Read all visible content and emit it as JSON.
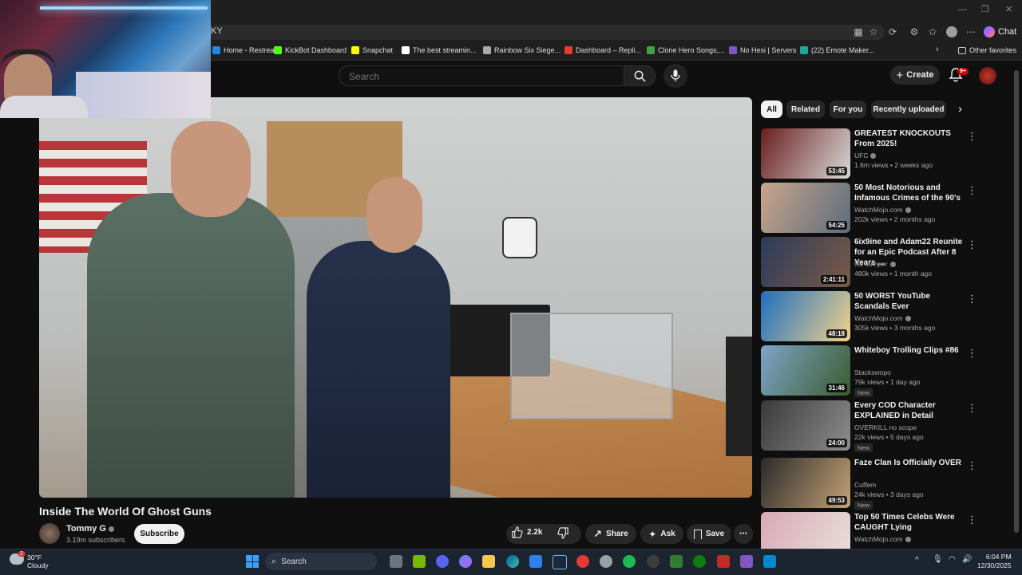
{
  "browser": {
    "address_text": "KY",
    "chat_label": "Chat",
    "bookmarks": [
      {
        "label": "Home - Restream",
        "color": "#1e88e5"
      },
      {
        "label": "KickBot Dashboard",
        "color": "#53fc18"
      },
      {
        "label": "Snapchat",
        "color": "#fffc00"
      },
      {
        "label": "The best streamin...",
        "color": "#ffffff"
      },
      {
        "label": "Rainbow Six Siege...",
        "color": "#aaaaaa"
      },
      {
        "label": "Dashboard – Repli...",
        "color": "#e53935"
      },
      {
        "label": "Clone Hero Songs,...",
        "color": "#43a047"
      },
      {
        "label": "No Hesi | Servers",
        "color": "#7e57c2"
      },
      {
        "label": "(22) Emote Maker...",
        "color": "#26a69a"
      }
    ],
    "other_favorites": "Other favorites"
  },
  "youtube": {
    "search_placeholder": "Search",
    "create_label": "Create",
    "notifications_badge": "9+",
    "video": {
      "title": "Inside The World Of Ghost Guns",
      "channel": "Tommy G",
      "subscribers": "3.19m subscribers",
      "subscribe_label": "Subscribe",
      "likes": "2.2k",
      "share_label": "Share",
      "ask_label": "Ask",
      "save_label": "Save"
    },
    "chips": [
      "All",
      "Related",
      "For you",
      "Recently uploaded"
    ],
    "recommendations": [
      {
        "title": "GREATEST KNOCKOUTS From 2025!",
        "channel": "UFC",
        "verified": true,
        "meta": "1.6m views • 2 weeks ago",
        "duration": "53:45",
        "new": "",
        "thumb_a": "#6b1e1e",
        "thumb_b": "#d9d9d9"
      },
      {
        "title": "50 Most Notorious and Infamous Crimes of the 90's",
        "channel": "WatchMojo.com",
        "verified": true,
        "meta": "202k views • 2 months ago",
        "duration": "54:25",
        "new": "",
        "thumb_a": "#caa58b",
        "thumb_b": "#5b6d7d"
      },
      {
        "title": "6ix9ine and Adam22 Reunite for an Epic Podcast After 8 Years ...",
        "channel": "No Jumper",
        "verified": true,
        "meta": "480k views • 1 month ago",
        "duration": "2:41:11",
        "new": "",
        "thumb_a": "#2c3b5a",
        "thumb_b": "#7a5a48"
      },
      {
        "title": "50 WORST YouTube Scandals Ever",
        "channel": "WatchMojo.com",
        "verified": true,
        "meta": "305k views • 3 months ago",
        "duration": "48:18",
        "new": "",
        "thumb_a": "#1d6fbf",
        "thumb_b": "#f2d28c"
      },
      {
        "title": "Whiteboy Trolling Clips #86",
        "channel": "Stackswopo",
        "verified": false,
        "meta": "79k views • 1 day ago",
        "duration": "31:46",
        "new": "New",
        "thumb_a": "#7fa4c7",
        "thumb_b": "#3b5c2e"
      },
      {
        "title": "Every COD Character EXPLAINED in Detail",
        "channel": "OVERKILL no scope",
        "verified": false,
        "meta": "22k views • 5 days ago",
        "duration": "24:00",
        "new": "New",
        "thumb_a": "#3a3a3a",
        "thumb_b": "#8d8d8d"
      },
      {
        "title": "Faze Clan Is Officially OVER",
        "channel": "Cuffem",
        "verified": false,
        "meta": "24k views • 3 days ago",
        "duration": "49:53",
        "new": "New",
        "thumb_a": "#2a2a2a",
        "thumb_b": "#c4a274"
      },
      {
        "title": "Top 50 Times Celebs Were CAUGHT Lying",
        "channel": "WatchMojo.com",
        "verified": true,
        "meta": "",
        "duration": "",
        "new": "",
        "thumb_a": "#d8a9b6",
        "thumb_b": "#e9e0dc"
      }
    ]
  },
  "taskbar": {
    "weather_temp": "30°F",
    "weather_desc": "Cloudy",
    "weather_badge": "2",
    "search_label": "Search",
    "time": "6:04 PM",
    "date": "12/30/2025"
  }
}
